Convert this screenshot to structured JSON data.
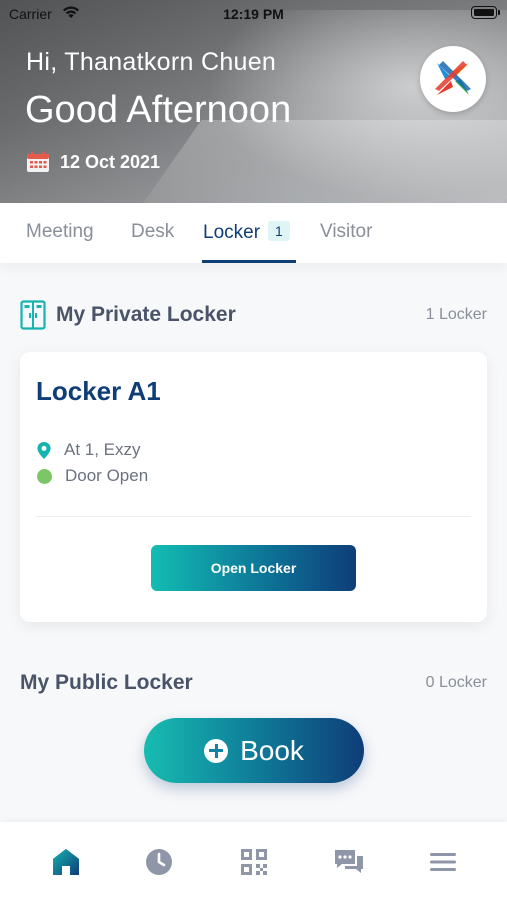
{
  "status_bar": {
    "carrier": "Carrier",
    "time": "12:19 PM"
  },
  "header": {
    "greeting": "Hi, Thanatkorn Chuen",
    "salutation": "Good Afternoon",
    "date": "12 Oct 2021",
    "logo_icon": "brand-x-logo"
  },
  "tabs": {
    "meeting": "Meeting",
    "desk": "Desk",
    "locker": "Locker",
    "locker_badge": "1",
    "visitor": "Visitor",
    "active": "Locker"
  },
  "private_section": {
    "title": "My Private Locker",
    "count": "1 Locker",
    "icon": "locker-icon"
  },
  "locker_card": {
    "name": "Locker A1",
    "location": "At 1, Exzy",
    "status": "Door Open",
    "status_color": "#7cc667",
    "button_label": "Open Locker"
  },
  "public_section": {
    "title": "My Public Locker",
    "count": "0 Locker"
  },
  "book_button": {
    "label": "Book",
    "icon": "plus-icon"
  },
  "bottom_nav": {
    "items": [
      {
        "icon": "home-icon",
        "active": true
      },
      {
        "icon": "clock-icon",
        "active": false
      },
      {
        "icon": "qr-code-icon",
        "active": false
      },
      {
        "icon": "chat-icon",
        "active": false
      },
      {
        "icon": "menu-icon",
        "active": false
      }
    ]
  },
  "colors": {
    "primary": "#0f3d78",
    "accent": "#12bdb3",
    "muted": "#8a8f99"
  }
}
